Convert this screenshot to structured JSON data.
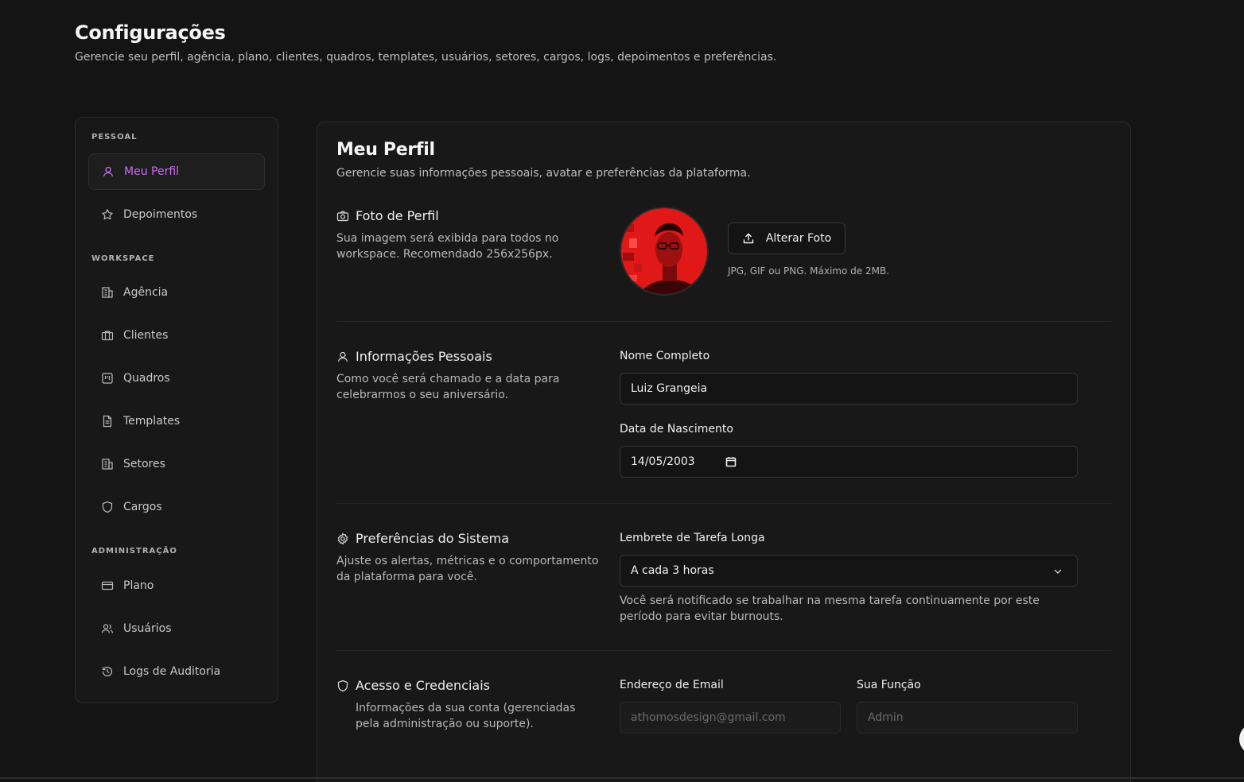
{
  "header": {
    "title": "Configurações",
    "subtitle": "Gerencie seu perfil, agência, plano, clientes, quadros, templates, usuários, setores, cargos, logs, depoimentos e preferências."
  },
  "sidebar": {
    "sections": [
      {
        "label": "PESSOAL"
      },
      {
        "label": "WORKSPACE"
      },
      {
        "label": "ADMINISTRAÇÃO"
      }
    ],
    "items": [
      {
        "label": "Meu Perfil",
        "icon": "user-icon",
        "active": true
      },
      {
        "label": "Depoimentos",
        "icon": "star-icon"
      },
      {
        "label": "Agência",
        "icon": "building-icon"
      },
      {
        "label": "Clientes",
        "icon": "briefcase-icon"
      },
      {
        "label": "Quadros",
        "icon": "board-icon"
      },
      {
        "label": "Templates",
        "icon": "document-icon"
      },
      {
        "label": "Setores",
        "icon": "building-icon"
      },
      {
        "label": "Cargos",
        "icon": "shield-icon"
      },
      {
        "label": "Plano",
        "icon": "credit-card-icon"
      },
      {
        "label": "Usuários",
        "icon": "users-icon"
      },
      {
        "label": "Logs de Auditoria",
        "icon": "history-icon"
      }
    ]
  },
  "profile": {
    "title": "Meu Perfil",
    "subtitle": "Gerencie suas informações pessoais, avatar e preferências da plataforma.",
    "photo": {
      "heading": "Foto de Perfil",
      "desc": "Sua imagem será exibida para todos no workspace. Recomendado 256x256px.",
      "button": "Alterar Foto",
      "hint": "JPG, GIF ou PNG. Máximo de 2MB."
    },
    "personal": {
      "heading": "Informações Pessoais",
      "desc": "Como você será chamado e a data para celebrarmos o seu aniversário.",
      "name_label": "Nome Completo",
      "name_value": "Luiz Grangeia",
      "birth_label": "Data de Nascimento",
      "birth_value": "14/05/2003"
    },
    "prefs": {
      "heading": "Preferências do Sistema",
      "desc": "Ajuste os alertas, métricas e o comportamento da plataforma para você.",
      "reminder_label": "Lembrete de Tarefa Longa",
      "reminder_value": "A cada 3 horas",
      "reminder_help": "Você será notificado se trabalhar na mesma tarefa continuamente por este período para evitar burnouts."
    },
    "access": {
      "heading": "Acesso e Credenciais",
      "desc": "Informações da sua conta (gerenciadas pela administração ou suporte).",
      "email_label": "Endereço de Email",
      "email_value": "athomosdesign@gmail.com",
      "role_label": "Sua Função",
      "role_value": "Admin"
    }
  },
  "colors": {
    "accent": "#c86ef0",
    "background": "#141414",
    "panel": "#181818",
    "avatar_red": "#e01818"
  }
}
